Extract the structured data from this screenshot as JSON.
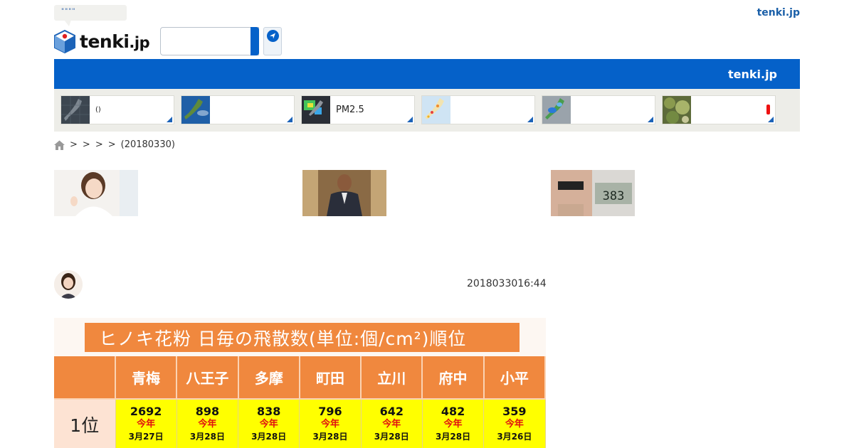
{
  "header": {
    "bubble_text": "\"\"\"\"",
    "logo_text": "tenki",
    "logo_suffix": ".jp",
    "top_link": "tenki.jp",
    "search_placeholder": ""
  },
  "bluebar": {
    "label": "tenki.jp"
  },
  "tiles": [
    {
      "label": "()",
      "map": "japan-radar-dark"
    },
    {
      "label": "",
      "map": "satellite-japan"
    },
    {
      "label": "PM2.5",
      "map": "pm25-map"
    },
    {
      "label": "",
      "map": "japan-weather-map"
    },
    {
      "label": "",
      "map": "rain-radar-map"
    },
    {
      "label": "",
      "map": "pollen-tree-photo"
    }
  ],
  "breadcrumb": {
    "separators": [
      ">",
      ">",
      ">",
      ">"
    ],
    "current": "(20180330)"
  },
  "article": {
    "date": "2018033016:44"
  },
  "pollen_table": {
    "title": "ヒノキ花粉 日毎の飛散数(単位:個/cm²)順位",
    "columns": [
      "青梅",
      "八王子",
      "多摩",
      "町田",
      "立川",
      "府中",
      "小平"
    ],
    "rank_label": "1位",
    "values": [
      "2692",
      "898",
      "838",
      "796",
      "642",
      "482",
      "359"
    ],
    "year_label": "今年",
    "dates": [
      "3月27日",
      "3月28日",
      "3月28日",
      "3月28日",
      "3月28日",
      "3月28日",
      "3月26日"
    ]
  },
  "colors": {
    "brand_blue": "#0561c9",
    "table_orange": "#f0883e",
    "highlight_yellow": "#ffff00",
    "year_red": "#e01010"
  }
}
